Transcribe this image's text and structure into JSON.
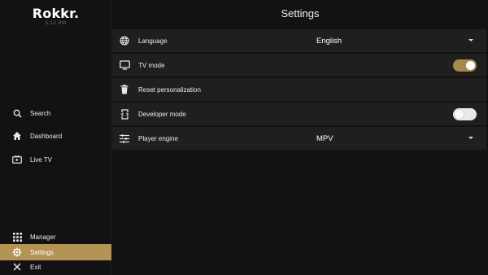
{
  "app": {
    "logo": "Rokkr.",
    "clock": "5:12 PM"
  },
  "page_title": "Settings",
  "sidebar": {
    "items": [
      {
        "label": "Search",
        "icon": "search-icon"
      },
      {
        "label": "Dashboard",
        "icon": "home-icon"
      },
      {
        "label": "Live TV",
        "icon": "tv-icon"
      },
      {
        "label": "Manager",
        "icon": "grid-icon"
      },
      {
        "label": "Settings",
        "icon": "gear-icon",
        "active": true
      },
      {
        "label": "Exit",
        "icon": "close-icon"
      }
    ]
  },
  "settings": {
    "language": {
      "label": "Language",
      "value": "English",
      "icon": "globe-icon"
    },
    "tv_mode": {
      "label": "TV mode",
      "enabled": true,
      "icon": "monitor-icon"
    },
    "reset": {
      "label": "Reset personalization",
      "icon": "trash-icon"
    },
    "developer_mode": {
      "label": "Developer mode",
      "enabled": false,
      "icon": "developer-icon"
    },
    "player_engine": {
      "label": "Player engine",
      "value": "MPV",
      "icon": "sliders-icon"
    }
  },
  "colors": {
    "accent": "#b39454",
    "toggle_on": "#a88a4e",
    "background": "#121212",
    "row_background": "#1f1f1f"
  }
}
